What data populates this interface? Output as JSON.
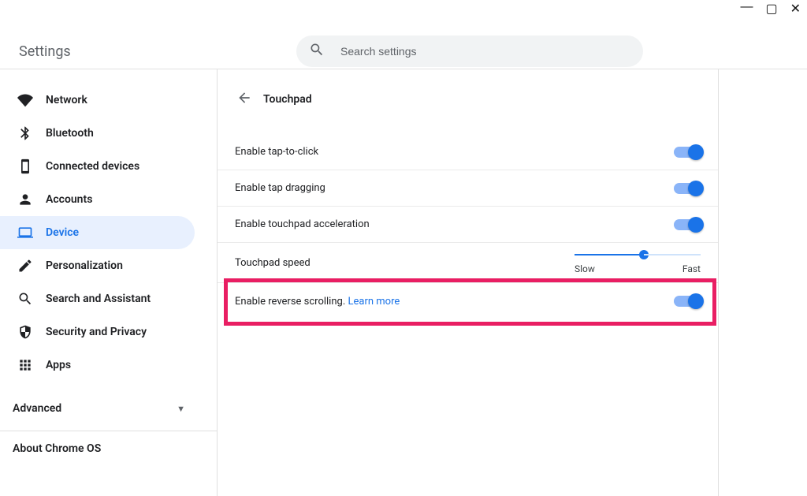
{
  "window": {
    "app_title": "Settings"
  },
  "search": {
    "placeholder": "Search settings"
  },
  "sidebar": {
    "items": [
      {
        "id": "network",
        "label": "Network"
      },
      {
        "id": "bluetooth",
        "label": "Bluetooth"
      },
      {
        "id": "connected-devices",
        "label": "Connected devices"
      },
      {
        "id": "accounts",
        "label": "Accounts"
      },
      {
        "id": "device",
        "label": "Device"
      },
      {
        "id": "personalization",
        "label": "Personalization"
      },
      {
        "id": "search-assistant",
        "label": "Search and Assistant"
      },
      {
        "id": "security-privacy",
        "label": "Security and Privacy"
      },
      {
        "id": "apps",
        "label": "Apps"
      }
    ],
    "advanced_label": "Advanced",
    "about_label": "About Chrome OS",
    "active_index": 4
  },
  "page": {
    "title": "Touchpad",
    "settings": {
      "tap_to_click": {
        "label": "Enable tap-to-click",
        "on": true
      },
      "tap_dragging": {
        "label": "Enable tap dragging",
        "on": true
      },
      "acceleration": {
        "label": "Enable touchpad acceleration",
        "on": true
      },
      "speed": {
        "label": "Touchpad speed",
        "min_label": "Slow",
        "max_label": "Fast",
        "value_percent": 55
      },
      "reverse_scrolling": {
        "label": "Enable reverse scrolling.",
        "learn_more": "Learn more",
        "on": true,
        "highlighted": true
      }
    }
  }
}
